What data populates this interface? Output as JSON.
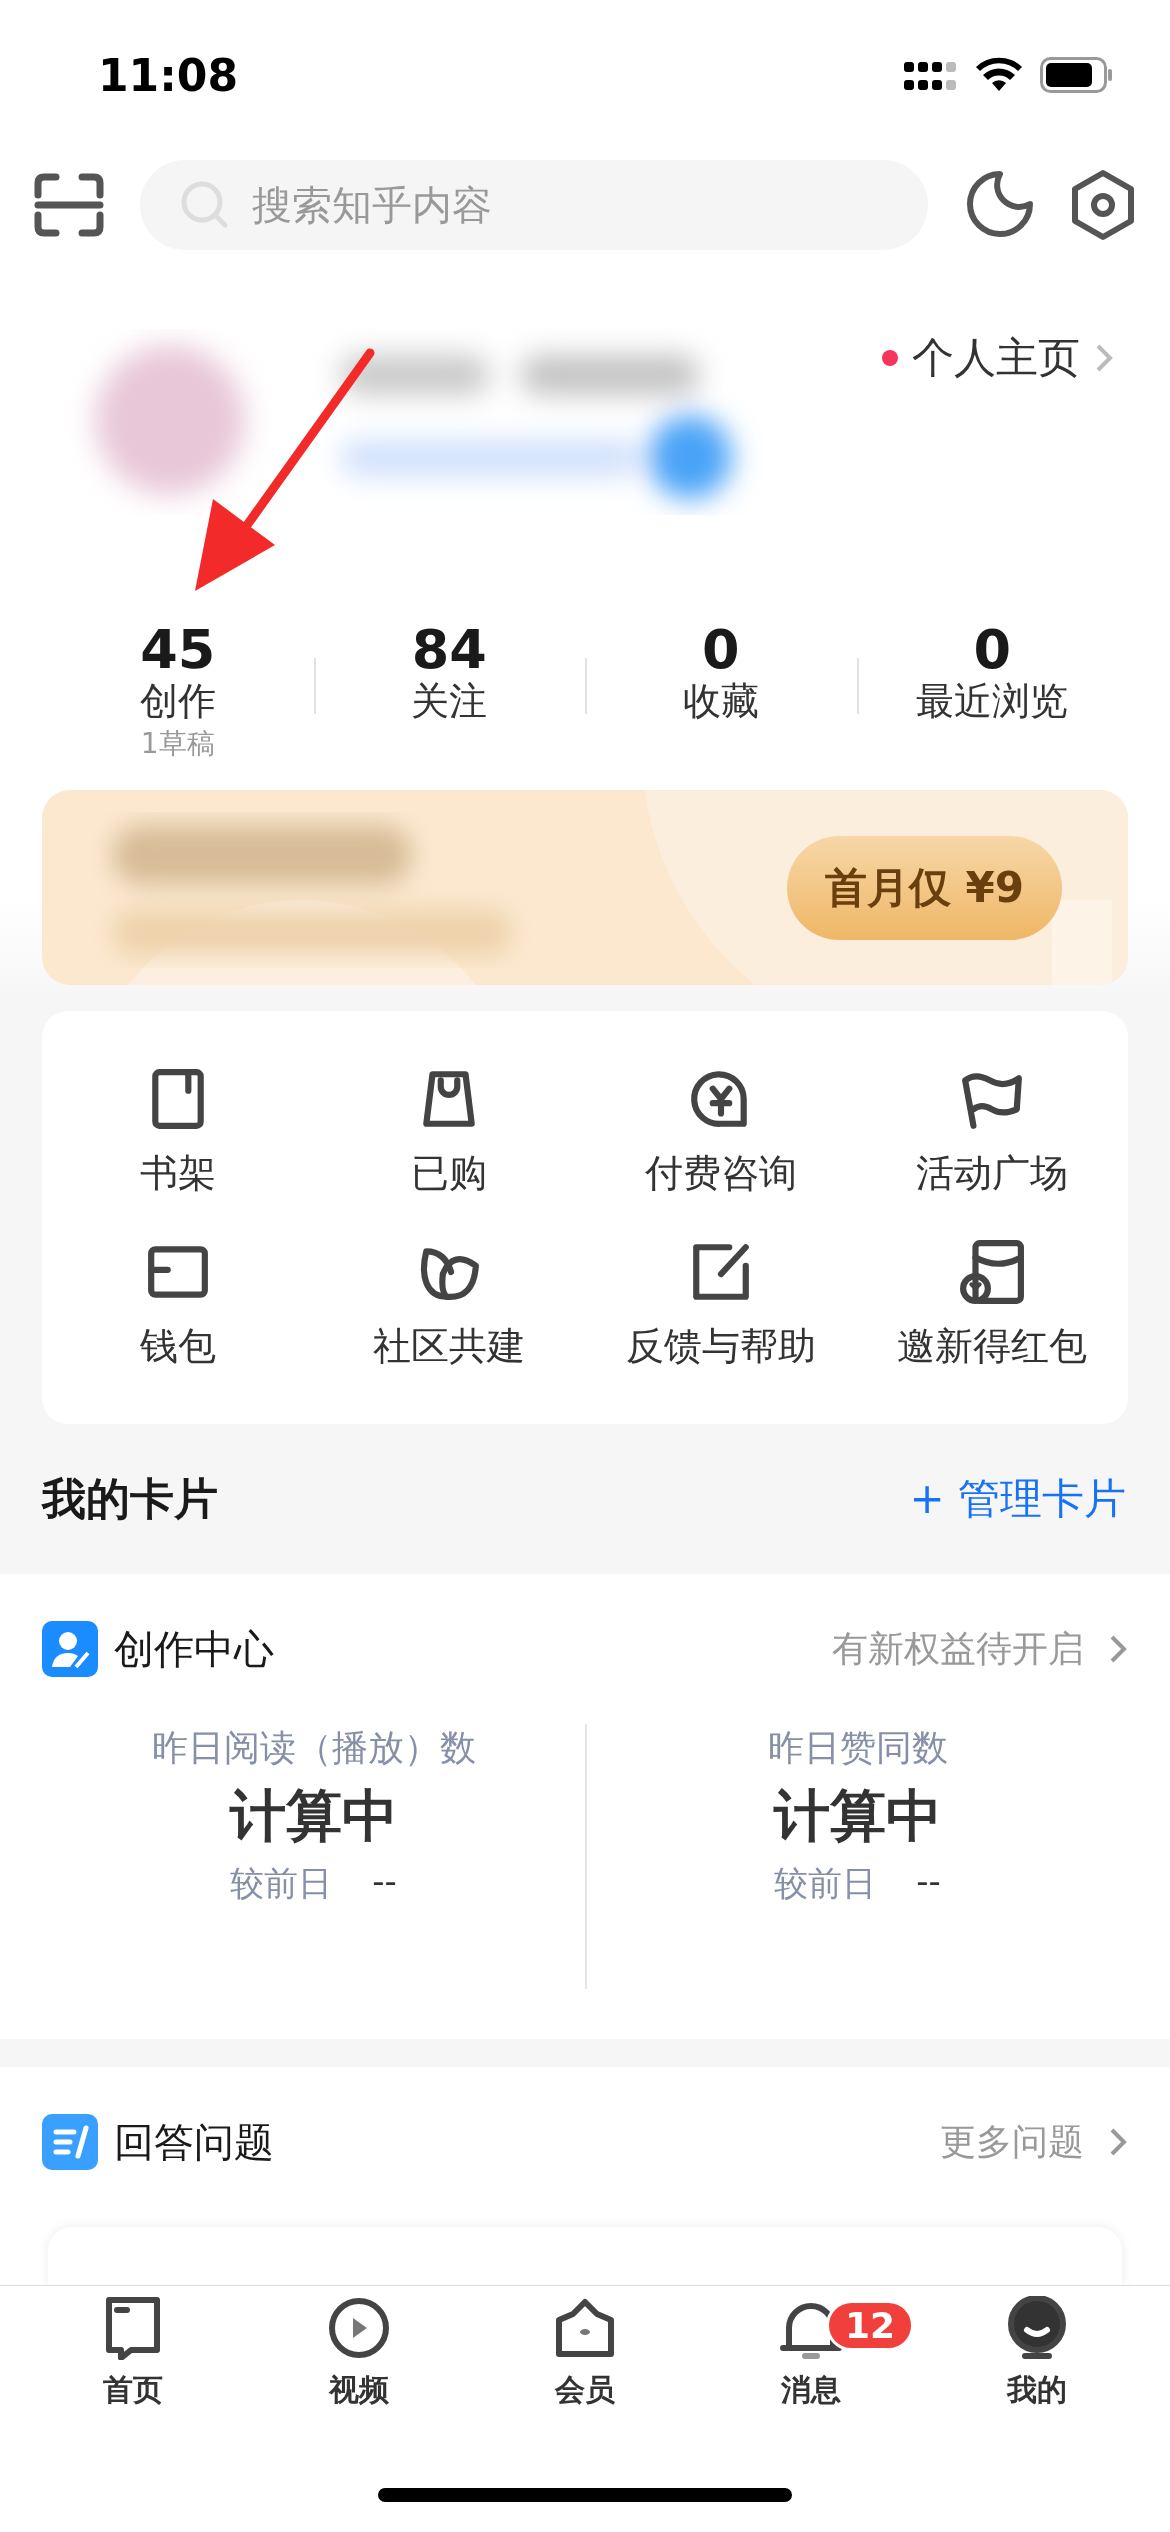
{
  "status_bar": {
    "time": "11:08"
  },
  "search": {
    "placeholder": "搜索知乎内容"
  },
  "profile": {
    "home_link": "个人主页",
    "unread": true
  },
  "stats": [
    {
      "value": "45",
      "label": "创作",
      "sub": "1草稿"
    },
    {
      "value": "84",
      "label": "关注"
    },
    {
      "value": "0",
      "label": "收藏"
    },
    {
      "value": "0",
      "label": "最近浏览"
    }
  ],
  "banner": {
    "button": "首月仅 ¥9"
  },
  "shortcuts": [
    {
      "label": "书架"
    },
    {
      "label": "已购"
    },
    {
      "label": "付费咨询"
    },
    {
      "label": "活动广场"
    },
    {
      "label": "钱包"
    },
    {
      "label": "社区共建"
    },
    {
      "label": "反馈与帮助"
    },
    {
      "label": "邀新得红包"
    }
  ],
  "cards_header": {
    "title": "我的卡片",
    "action": "+ 管理卡片"
  },
  "creator": {
    "title": "创作中心",
    "link": "有新权益待开启",
    "metrics": [
      {
        "label": "昨日阅读（播放）数",
        "value": "计算中",
        "compare_label": "较前日",
        "compare_value": "--"
      },
      {
        "label": "昨日赞同数",
        "value": "计算中",
        "compare_label": "较前日",
        "compare_value": "--"
      }
    ]
  },
  "answer": {
    "title": "回答问题",
    "link": "更多问题"
  },
  "tab_bar": [
    {
      "label": "首页",
      "selected": false
    },
    {
      "label": "视频",
      "selected": false
    },
    {
      "label": "会员",
      "selected": false
    },
    {
      "label": "消息",
      "selected": false,
      "badge": "12"
    },
    {
      "label": "我的",
      "selected": true
    }
  ]
}
